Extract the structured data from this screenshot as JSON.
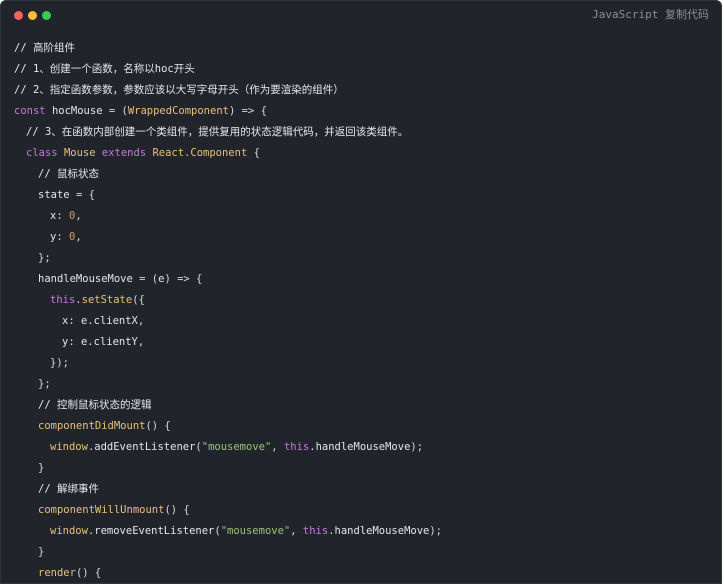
{
  "header": {
    "language_label": "JavaScript 复制代码"
  },
  "code_lines": [
    {
      "indent": 0,
      "tokens": [
        {
          "c": "comment",
          "t": "// 高阶组件"
        }
      ]
    },
    {
      "indent": 0,
      "tokens": [
        {
          "c": "comment",
          "t": "// 1、创建一个函数，名称以hoc开头"
        }
      ]
    },
    {
      "indent": 0,
      "tokens": [
        {
          "c": "comment",
          "t": "// 2、指定函数参数，参数应该以大写字母开头（作为要渲染的组件）"
        }
      ]
    },
    {
      "indent": 0,
      "tokens": [
        {
          "c": "kw",
          "t": "const "
        },
        {
          "c": "var",
          "t": "hocMouse "
        },
        {
          "c": "punc",
          "t": "= ("
        },
        {
          "c": "fn",
          "t": "WrappedComponent"
        },
        {
          "c": "punc",
          "t": ") => {"
        }
      ]
    },
    {
      "indent": 1,
      "tokens": [
        {
          "c": "comment",
          "t": "// 3、在函数内部创建一个类组件，提供复用的状态逻辑代码，并返回该类组件。"
        }
      ]
    },
    {
      "indent": 1,
      "tokens": [
        {
          "c": "kw",
          "t": "class "
        },
        {
          "c": "class",
          "t": "Mouse "
        },
        {
          "c": "kw",
          "t": "extends "
        },
        {
          "c": "class",
          "t": "React.Component "
        },
        {
          "c": "punc",
          "t": "{"
        }
      ]
    },
    {
      "indent": 2,
      "tokens": [
        {
          "c": "comment",
          "t": "// 鼠标状态"
        }
      ]
    },
    {
      "indent": 2,
      "tokens": [
        {
          "c": "var",
          "t": "state "
        },
        {
          "c": "punc",
          "t": "= {"
        }
      ]
    },
    {
      "indent": 3,
      "tokens": [
        {
          "c": "prop",
          "t": "x"
        },
        {
          "c": "punc",
          "t": ": "
        },
        {
          "c": "num",
          "t": "0"
        },
        {
          "c": "punc",
          "t": ","
        }
      ]
    },
    {
      "indent": 3,
      "tokens": [
        {
          "c": "prop",
          "t": "y"
        },
        {
          "c": "punc",
          "t": ": "
        },
        {
          "c": "num",
          "t": "0"
        },
        {
          "c": "punc",
          "t": ","
        }
      ]
    },
    {
      "indent": 2,
      "tokens": [
        {
          "c": "punc",
          "t": "};"
        }
      ]
    },
    {
      "indent": 2,
      "tokens": [
        {
          "c": "var",
          "t": "handleMouseMove "
        },
        {
          "c": "punc",
          "t": "= ("
        },
        {
          "c": "param",
          "t": "e"
        },
        {
          "c": "punc",
          "t": ") => {"
        }
      ]
    },
    {
      "indent": 3,
      "tokens": [
        {
          "c": "kw",
          "t": "this"
        },
        {
          "c": "punc",
          "t": "."
        },
        {
          "c": "fn",
          "t": "setState"
        },
        {
          "c": "punc",
          "t": "({"
        }
      ]
    },
    {
      "indent": 4,
      "tokens": [
        {
          "c": "prop",
          "t": "x"
        },
        {
          "c": "punc",
          "t": ": "
        },
        {
          "c": "var",
          "t": "e.clientX"
        },
        {
          "c": "punc",
          "t": ","
        }
      ]
    },
    {
      "indent": 4,
      "tokens": [
        {
          "c": "prop",
          "t": "y"
        },
        {
          "c": "punc",
          "t": ": "
        },
        {
          "c": "var",
          "t": "e.clientY"
        },
        {
          "c": "punc",
          "t": ","
        }
      ]
    },
    {
      "indent": 3,
      "tokens": [
        {
          "c": "punc",
          "t": "});"
        }
      ]
    },
    {
      "indent": 2,
      "tokens": [
        {
          "c": "punc",
          "t": "};"
        }
      ]
    },
    {
      "indent": 2,
      "tokens": [
        {
          "c": "comment",
          "t": "// 控制鼠标状态的逻辑"
        }
      ]
    },
    {
      "indent": 2,
      "tokens": [
        {
          "c": "fn",
          "t": "componentDidMount"
        },
        {
          "c": "punc",
          "t": "() {"
        }
      ]
    },
    {
      "indent": 3,
      "tokens": [
        {
          "c": "fn",
          "t": "window"
        },
        {
          "c": "punc",
          "t": "."
        },
        {
          "c": "var",
          "t": "addEventListener"
        },
        {
          "c": "punc",
          "t": "("
        },
        {
          "c": "str",
          "t": "\"mousemove\""
        },
        {
          "c": "punc",
          "t": ", "
        },
        {
          "c": "kw",
          "t": "this"
        },
        {
          "c": "punc",
          "t": "."
        },
        {
          "c": "var",
          "t": "handleMouseMove"
        },
        {
          "c": "punc",
          "t": ");"
        }
      ]
    },
    {
      "indent": 2,
      "tokens": [
        {
          "c": "punc",
          "t": "}"
        }
      ]
    },
    {
      "indent": 2,
      "tokens": [
        {
          "c": "comment",
          "t": "// 解绑事件"
        }
      ]
    },
    {
      "indent": 2,
      "tokens": [
        {
          "c": "fn",
          "t": "componentWillUnmount"
        },
        {
          "c": "punc",
          "t": "() {"
        }
      ]
    },
    {
      "indent": 3,
      "tokens": [
        {
          "c": "fn",
          "t": "window"
        },
        {
          "c": "punc",
          "t": "."
        },
        {
          "c": "var",
          "t": "removeEventListener"
        },
        {
          "c": "punc",
          "t": "("
        },
        {
          "c": "str",
          "t": "\"mousemove\""
        },
        {
          "c": "punc",
          "t": ", "
        },
        {
          "c": "kw",
          "t": "this"
        },
        {
          "c": "punc",
          "t": "."
        },
        {
          "c": "var",
          "t": "handleMouseMove"
        },
        {
          "c": "punc",
          "t": ");"
        }
      ]
    },
    {
      "indent": 2,
      "tokens": [
        {
          "c": "punc",
          "t": "}"
        }
      ]
    },
    {
      "indent": 2,
      "tokens": [
        {
          "c": "fn",
          "t": "render"
        },
        {
          "c": "punc",
          "t": "() {"
        }
      ]
    }
  ]
}
